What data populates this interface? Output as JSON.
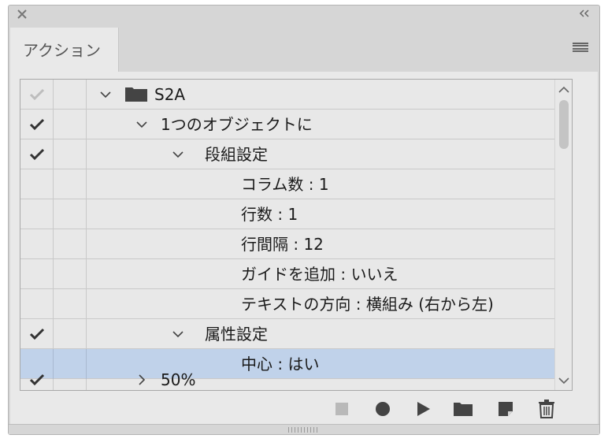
{
  "panel": {
    "tab_label": "アクション"
  },
  "rows": [
    {
      "check": "light",
      "chevron": "down",
      "folder": true,
      "label": "S2A",
      "indent": 0
    },
    {
      "check": "dark",
      "chevron": "down",
      "folder": false,
      "label": "1つのオブジェクトに",
      "indent": 1
    },
    {
      "check": "dark",
      "chevron": "down",
      "folder": false,
      "label": "段組設定",
      "indent": 2
    },
    {
      "check": "none",
      "chevron": "none",
      "folder": false,
      "label": "コラム数 : 1",
      "indent": 3
    },
    {
      "check": "none",
      "chevron": "none",
      "folder": false,
      "label": "行数 : 1",
      "indent": 3
    },
    {
      "check": "none",
      "chevron": "none",
      "folder": false,
      "label": "行間隔 : 12",
      "indent": 3
    },
    {
      "check": "none",
      "chevron": "none",
      "folder": false,
      "label": "ガイドを追加 : いいえ",
      "indent": 3
    },
    {
      "check": "none",
      "chevron": "none",
      "folder": false,
      "label": "テキストの方向 : 横組み (右から左)",
      "indent": 3
    },
    {
      "check": "dark",
      "chevron": "down",
      "folder": false,
      "label": "属性設定",
      "indent": 2
    },
    {
      "check": "none",
      "chevron": "none",
      "folder": false,
      "label": "中心 : はい",
      "indent": 3,
      "selected": true
    },
    {
      "check": "dark",
      "chevron": "right",
      "folder": false,
      "label": "50%",
      "indent": 1,
      "partial": true
    }
  ],
  "toolbar": {
    "buttons": [
      "stop-button",
      "record-button",
      "play-button",
      "new-set-button",
      "new-action-button",
      "delete-button"
    ]
  },
  "colors": {
    "selection": "#c0d2ea",
    "panel_bg": "#d6d6d6",
    "list_bg": "#e8e8e8"
  }
}
